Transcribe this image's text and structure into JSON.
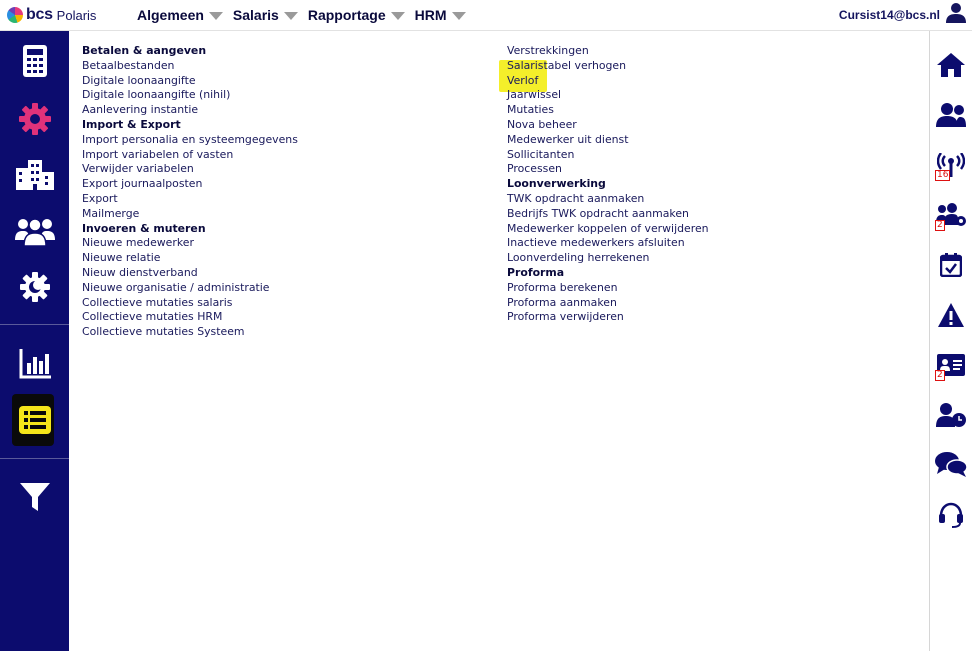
{
  "header": {
    "logo_text": "bcs",
    "logo_sub": "Polaris",
    "menu": [
      {
        "label": "Algemeen"
      },
      {
        "label": "Salaris"
      },
      {
        "label": "Rapportage"
      },
      {
        "label": "HRM"
      }
    ],
    "user_email": "Cursist14@bcs.nl",
    "icons": {
      "user": "user-icon"
    }
  },
  "left_sidebar": {
    "items": [
      {
        "icon": "calculator-icon"
      },
      {
        "icon": "gear-icon"
      },
      {
        "icon": "building-icon"
      },
      {
        "icon": "people-icon"
      },
      {
        "icon": "moon-gear-icon"
      },
      {
        "icon": "bar-chart-icon"
      },
      {
        "icon": "list-icon",
        "active": true
      },
      {
        "icon": "filter-icon"
      }
    ],
    "colors": {
      "background": "#0c0c6e",
      "active_icon": "#f6e61a",
      "gear_accent": "#e0327a"
    }
  },
  "content": {
    "left_column": [
      {
        "text": "Betalen & aangeven",
        "header": true
      },
      {
        "text": "Betaalbestanden"
      },
      {
        "text": "Digitale loonaangifte"
      },
      {
        "text": "Digitale loonaangifte (nihil)"
      },
      {
        "text": "Aanlevering instantie"
      },
      {
        "text": "Import & Export",
        "header": true
      },
      {
        "text": "Import personalia en systeemgegevens"
      },
      {
        "text": "Import variabelen of vasten"
      },
      {
        "text": "Verwijder variabelen"
      },
      {
        "text": "Export journaalposten"
      },
      {
        "text": "Export"
      },
      {
        "text": "Mailmerge"
      },
      {
        "text": "Invoeren & muteren",
        "header": true
      },
      {
        "text": "Nieuwe medewerker"
      },
      {
        "text": "Nieuwe relatie"
      },
      {
        "text": "Nieuw dienstverband"
      },
      {
        "text": "Nieuwe organisatie / administratie"
      },
      {
        "text": "Collectieve mutaties salaris"
      },
      {
        "text": "Collectieve mutaties HRM"
      },
      {
        "text": "Collectieve mutaties Systeem"
      }
    ],
    "right_column": [
      {
        "text": "Verstrekkingen"
      },
      {
        "text": "Salaristabel verhogen"
      },
      {
        "text": "Verlof",
        "highlighted": true
      },
      {
        "text": "Jaarwissel"
      },
      {
        "text": "Mutaties"
      },
      {
        "text": "Nova beheer"
      },
      {
        "text": "Medewerker uit dienst"
      },
      {
        "text": "Sollicitanten"
      },
      {
        "text": "Processen"
      },
      {
        "text": "Loonverwerking",
        "header": true
      },
      {
        "text": "TWK opdracht aanmaken"
      },
      {
        "text": "Bedrijfs TWK opdracht aanmaken"
      },
      {
        "text": "Medewerker koppelen of verwijderen"
      },
      {
        "text": "Inactieve medewerkers afsluiten"
      },
      {
        "text": "Loonverdeling herrekenen"
      },
      {
        "text": "Proforma",
        "header": true
      },
      {
        "text": "Proforma berekenen"
      },
      {
        "text": "Proforma aanmaken"
      },
      {
        "text": "Proforma verwijderen"
      }
    ],
    "colors": {
      "highlight": "#f6ef1a"
    }
  },
  "right_sidebar": {
    "items": [
      {
        "icon": "home-icon",
        "badge": ""
      },
      {
        "icon": "users-icon",
        "badge": ""
      },
      {
        "icon": "broadcast-icon",
        "badge": "16"
      },
      {
        "icon": "users-settings-icon",
        "badge": "2"
      },
      {
        "icon": "calendar-check-icon",
        "badge": ""
      },
      {
        "icon": "warning-icon",
        "badge": ""
      },
      {
        "icon": "id-card-icon",
        "badge": "2"
      },
      {
        "icon": "user-clock-icon",
        "badge": ""
      },
      {
        "icon": "chat-icon",
        "badge": ""
      },
      {
        "icon": "headset-icon",
        "badge": ""
      }
    ]
  }
}
